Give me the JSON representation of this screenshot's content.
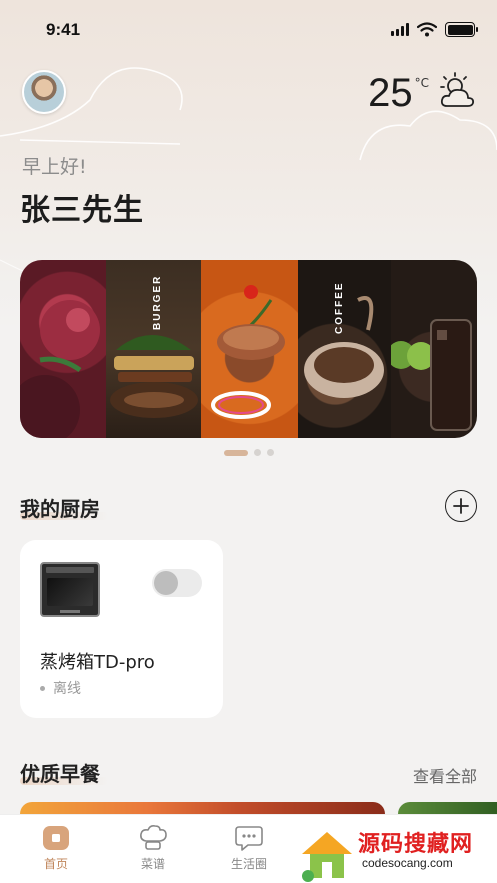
{
  "status_bar": {
    "time": "9:41"
  },
  "weather": {
    "temperature": "25",
    "unit": "°C",
    "icon": "partly-cloudy-icon"
  },
  "greeting": "早上好!",
  "user_name": "张三先生",
  "banner": {
    "panels": [
      "BURGER",
      "COFFEE"
    ],
    "page_count": 3,
    "active_page": 1
  },
  "kitchen": {
    "title": "我的厨房",
    "add_icon": "plus-circle-icon",
    "devices": [
      {
        "name": "蒸烤箱TD-pro",
        "status": "离线",
        "power_on": false
      }
    ]
  },
  "breakfast": {
    "title": "优质早餐",
    "see_all": "查看全部"
  },
  "tabbar": {
    "items": [
      {
        "label": "首页",
        "icon": "home-icon",
        "active": true
      },
      {
        "label": "菜谱",
        "icon": "chef-hat-icon",
        "active": false
      },
      {
        "label": "生活圈",
        "icon": "chat-bubble-icon",
        "active": false
      }
    ]
  },
  "watermark": {
    "text": "源码搜藏网",
    "url": "codesocang.com"
  },
  "colors": {
    "accent": "#c0865b",
    "background": "#f3f2f1"
  }
}
